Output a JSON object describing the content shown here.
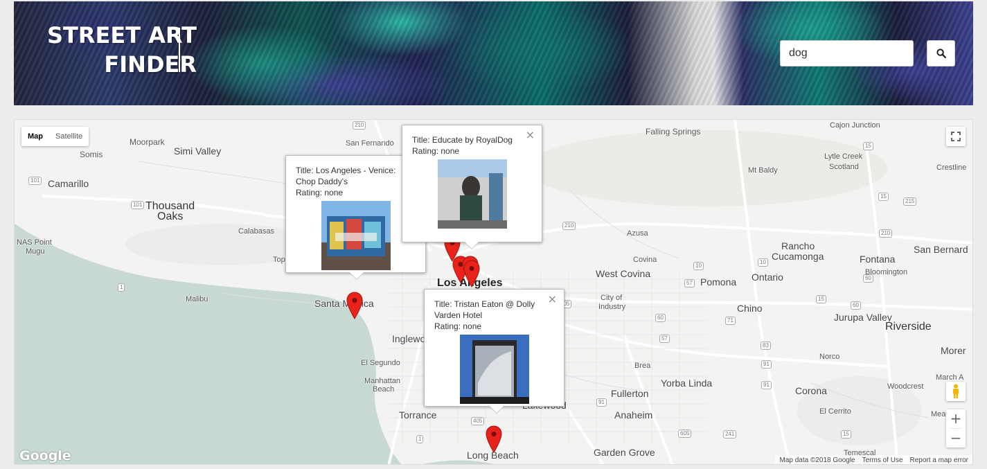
{
  "header": {
    "logo_line1": "STREET ART",
    "logo_line2": "FINDER"
  },
  "search": {
    "value": "dog",
    "button_icon": "search-icon"
  },
  "map": {
    "map_type": {
      "map_label": "Map",
      "satellite_label": "Satellite",
      "selected": "Map"
    },
    "controls": {
      "fullscreen_icon": "fullscreen-icon",
      "pegman_icon": "pegman-icon",
      "zoom_in": "+",
      "zoom_out": "−"
    },
    "google_logo": "Google",
    "attribution": {
      "map_data": "Map data ©2018 Google",
      "terms": "Terms of Use",
      "report": "Report a map error"
    },
    "places": [
      "Somis",
      "Moorpark",
      "Simi Valley",
      "San Fernando",
      "Falling Springs",
      "Cajon Junction",
      "Mt Baldy",
      "Lytle Creek",
      "Scotland",
      "Crestline",
      "Camarillo",
      "Thousand",
      "Oaks",
      "Calabasas",
      "NAS Point",
      "Mugu",
      "Azusa",
      "Rancho",
      "Cucamonga",
      "San Bernard",
      "Covina",
      "West Covina",
      "Pomona",
      "Ontario",
      "Fontana",
      "Bloomington",
      "Los Angeles",
      "Malibu",
      "Santa Monica",
      "City of",
      "Industry",
      "Chino",
      "Jurupa Valley",
      "Riverside",
      "Inglewood",
      "El Segundo",
      "Manhattan",
      "Beach",
      "Norco",
      "Morer",
      "Brea",
      "Yorba Linda",
      "Corona",
      "Woodcrest",
      "March A",
      "Fullerton",
      "Torrance",
      "Anaheim",
      "El Cerrito",
      "Mead",
      "Long Beach",
      "Garden Grove",
      "Temescal",
      "Top",
      "Lakewood"
    ],
    "route_shields": [
      "210",
      "101",
      "101",
      "15",
      "15",
      "215",
      "210",
      "210",
      "1",
      "57",
      "10",
      "60",
      "15",
      "60",
      "71",
      "57",
      "83",
      "91",
      "91",
      "405",
      "605",
      "91",
      "241",
      "15",
      "1",
      "60",
      "10",
      "805"
    ],
    "pin_color": "#e8231c"
  },
  "info_windows": [
    {
      "title": "Title: Los Angeles - Venice: Chop Daddy's",
      "rating": "Rating: none",
      "close": "×"
    },
    {
      "title": "Title: Educate by RoyalDog",
      "rating": "Rating: none",
      "close": "×"
    },
    {
      "title": "Title: Tristan Eaton @ Dolly Varden Hotel",
      "rating": "Rating: none",
      "close": "×"
    }
  ]
}
